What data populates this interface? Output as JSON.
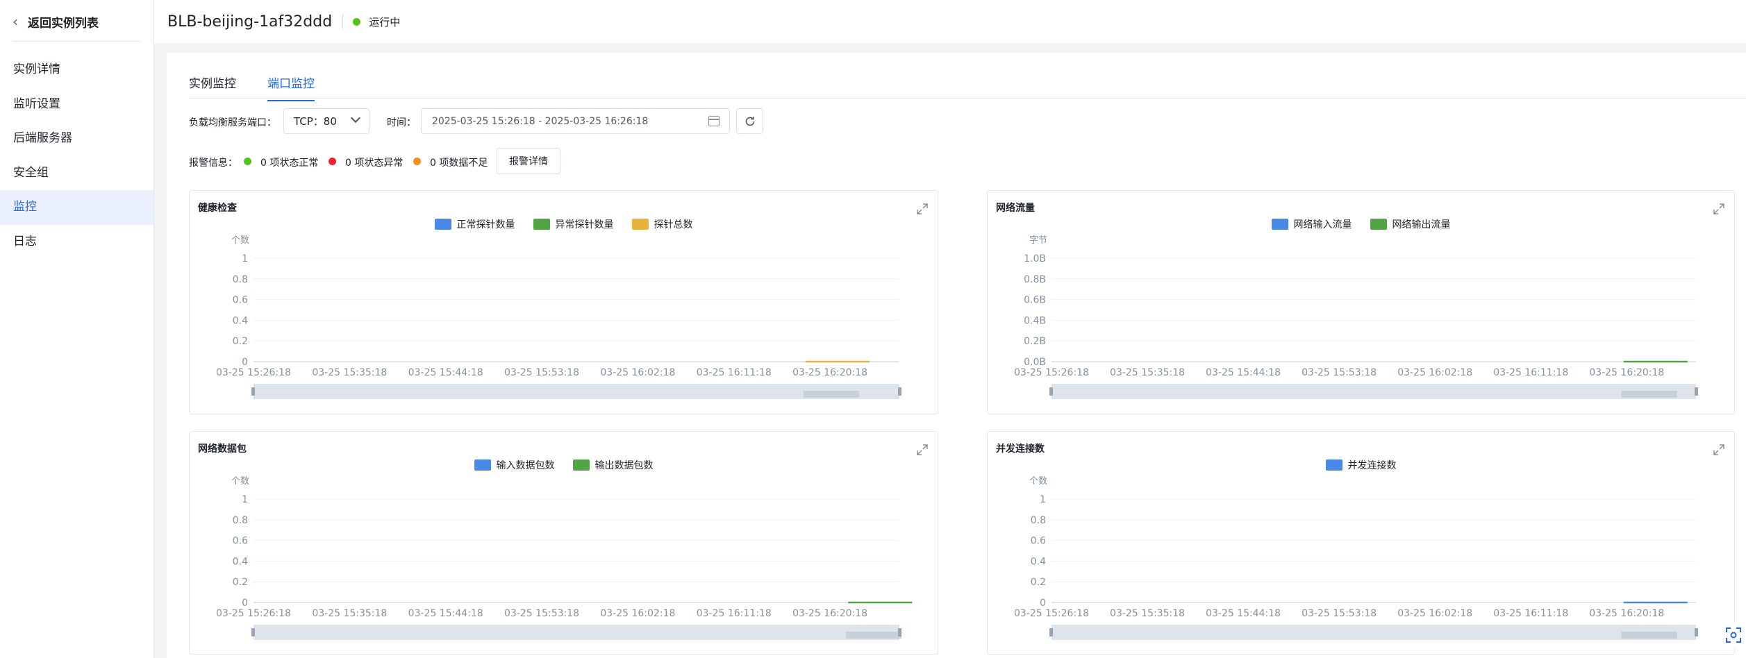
{
  "sidebar": {
    "back_label": "返回实例列表",
    "items": [
      {
        "label": "实例详情",
        "active": false
      },
      {
        "label": "监听设置",
        "active": false
      },
      {
        "label": "后端服务器",
        "active": false
      },
      {
        "label": "安全组",
        "active": false
      },
      {
        "label": "监控",
        "active": true
      },
      {
        "label": "日志",
        "active": false
      }
    ]
  },
  "header": {
    "title": "BLB-beijing-1af32ddd",
    "status": "运行中",
    "status_color": "#52c41a"
  },
  "tabs": [
    {
      "label": "实例监控",
      "active": false
    },
    {
      "label": "端口监控",
      "active": true
    }
  ],
  "filters": {
    "port_label": "负载均衡服务端口：",
    "port_value": "TCP：80",
    "time_label": "时间：",
    "time_value": "2025-03-25 15:26:18 - 2025-03-25 16:26:18"
  },
  "alarm": {
    "label": "报警信息：",
    "items": [
      {
        "text": "0 项状态正常",
        "color": "#52c41a"
      },
      {
        "text": "0 项状态异常",
        "color": "#f5222d"
      },
      {
        "text": "0 项数据不足",
        "color": "#fa8c16"
      }
    ],
    "detail_button": "报警详情"
  },
  "panels": [
    {
      "title": "健康检查",
      "legend": [
        {
          "name": "正常探针数量",
          "color": "#4a89e8"
        },
        {
          "name": "异常探针数量",
          "color": "#52a447"
        },
        {
          "name": "探针总数",
          "color": "#e8b33a"
        }
      ]
    },
    {
      "title": "网络流量",
      "legend": [
        {
          "name": "网络输入流量",
          "color": "#4a89e8"
        },
        {
          "name": "网络输出流量",
          "color": "#52a447"
        }
      ]
    },
    {
      "title": "网络数据包",
      "legend": [
        {
          "name": "输入数据包数",
          "color": "#4a89e8"
        },
        {
          "name": "输出数据包数",
          "color": "#52a447"
        }
      ]
    },
    {
      "title": "并发连接数",
      "legend": [
        {
          "name": "并发连接数",
          "color": "#4a89e8"
        }
      ]
    }
  ],
  "chart_data": [
    {
      "type": "line",
      "title": "健康检查",
      "ylabel": "个数",
      "yticks": [
        "0",
        "0.2",
        "0.4",
        "0.6",
        "0.8",
        "1"
      ],
      "ylim": [
        0,
        1
      ],
      "x": [
        "03-25 15:26:18",
        "03-25 15:35:18",
        "03-25 15:44:18",
        "03-25 15:53:18",
        "03-25 16:02:18",
        "03-25 16:11:18",
        "03-25 16:20:18"
      ],
      "series": [
        {
          "name": "探针总数",
          "color": "#e8b33a",
          "points": [
            {
              "x": "03-25 16:18:00",
              "y": 0
            },
            {
              "x": "03-25 16:24:00",
              "y": 0
            }
          ]
        }
      ]
    },
    {
      "type": "line",
      "title": "网络流量",
      "ylabel": "字节",
      "yticks": [
        "0.0B",
        "0.2B",
        "0.4B",
        "0.6B",
        "0.8B",
        "1.0B"
      ],
      "ylim": [
        0,
        1
      ],
      "x": [
        "03-25 15:26:18",
        "03-25 15:35:18",
        "03-25 15:44:18",
        "03-25 15:53:18",
        "03-25 16:02:18",
        "03-25 16:11:18",
        "03-25 16:20:18"
      ],
      "series": [
        {
          "name": "网络输出流量",
          "color": "#52a447",
          "points": [
            {
              "x": "03-25 16:20:00",
              "y": 0
            },
            {
              "x": "03-25 16:26:00",
              "y": 0
            }
          ]
        }
      ]
    },
    {
      "type": "line",
      "title": "网络数据包",
      "ylabel": "个数",
      "yticks": [
        "0",
        "0.2",
        "0.4",
        "0.6",
        "0.8",
        "1"
      ],
      "ylim": [
        0,
        1
      ],
      "x": [
        "03-25 15:26:18",
        "03-25 15:35:18",
        "03-25 15:44:18",
        "03-25 15:53:18",
        "03-25 16:02:18",
        "03-25 16:11:18",
        "03-25 16:20:18"
      ],
      "series": [
        {
          "name": "输出数据包数",
          "color": "#52a447",
          "points": [
            {
              "x": "03-25 16:22:00",
              "y": 0
            },
            {
              "x": "03-25 16:28:00",
              "y": 0
            }
          ]
        }
      ]
    },
    {
      "type": "line",
      "title": "并发连接数",
      "ylabel": "个数",
      "yticks": [
        "0",
        "0.2",
        "0.4",
        "0.6",
        "0.8",
        "1"
      ],
      "ylim": [
        0,
        1
      ],
      "x": [
        "03-25 15:26:18",
        "03-25 15:35:18",
        "03-25 15:44:18",
        "03-25 15:53:18",
        "03-25 16:02:18",
        "03-25 16:11:18",
        "03-25 16:20:18"
      ],
      "series": [
        {
          "name": "并发连接数",
          "color": "#4a89e8",
          "points": [
            {
              "x": "03-25 16:20:00",
              "y": 0
            },
            {
              "x": "03-25 16:26:00",
              "y": 0
            }
          ]
        }
      ]
    }
  ]
}
